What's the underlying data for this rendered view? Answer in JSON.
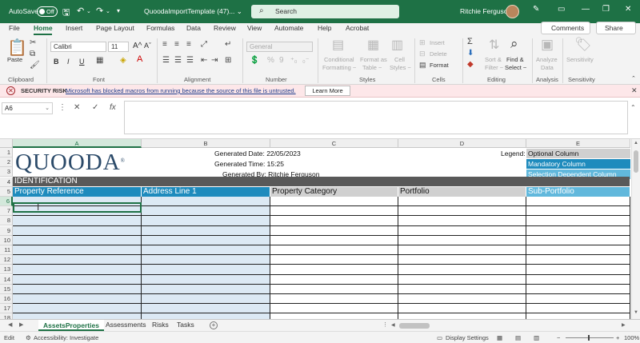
{
  "titlebar": {
    "autosave_label": "AutoSave",
    "autosave_state": "Off",
    "doc_title": "QuoodaImportTemplate (47)...",
    "doc_title_dropdown": "⌄",
    "search_placeholder": "Search",
    "user_name": "Ritchie Ferguson",
    "icons": [
      "save-icon",
      "undo-icon",
      "redo-icon",
      "customize-icon",
      "pen-icon",
      "ribbon-display-icon",
      "minimize-icon",
      "restore-icon",
      "close-icon"
    ]
  },
  "ribbon": {
    "tabs": [
      "File",
      "Home",
      "Insert",
      "Page Layout",
      "Formulas",
      "Data",
      "Review",
      "View",
      "Automate",
      "Help",
      "Acrobat"
    ],
    "active_tab": "Home",
    "comments_label": "Comments",
    "share_label": "Share",
    "clipboard": {
      "paste_label": "Paste",
      "group_label": "Clipboard"
    },
    "font": {
      "font_name": "Calibri",
      "font_size": "11",
      "bold": "B",
      "italic": "I",
      "underline": "U",
      "grow": "A^",
      "shrink": "Aˇ",
      "group_label": "Font"
    },
    "alignment": {
      "group_label": "Alignment"
    },
    "number": {
      "format": "General",
      "group_label": "Number"
    },
    "styles": {
      "conditional": "Conditional",
      "conditional2": "Formatting ~",
      "format_as": "Format as",
      "format_as2": "Table ~",
      "cell_styles": "Cell",
      "cell_styles2": "Styles ~",
      "group_label": "Styles"
    },
    "cells": {
      "insert": "Insert",
      "delete": "Delete",
      "format": "Format",
      "group_label": "Cells"
    },
    "editing": {
      "sort": "Sort &",
      "sort2": "Filter ~",
      "find": "Find &",
      "find2": "Select ~",
      "group_label": "Editing"
    },
    "analysis": {
      "analyze": "Analyze",
      "analyze2": "Data",
      "group_label": "Analysis"
    },
    "sensitivity": {
      "label": "Sensitivity",
      "group_label": "Sensitivity"
    }
  },
  "security": {
    "label": "SECURITY RISK",
    "message": "Microsoft has blocked macros from running because the source of this file is untrusted.",
    "learn_more": "Learn More"
  },
  "formula": {
    "namebox": "A6",
    "cancel_glyph": "✕",
    "enter_glyph": "✓",
    "fx_glyph": "fx",
    "value": ""
  },
  "grid": {
    "columns": [
      "A",
      "B",
      "C",
      "D",
      "E"
    ],
    "rows": [
      "1",
      "2",
      "3",
      "4",
      "5",
      "6",
      "7",
      "8",
      "9",
      "10",
      "11",
      "12",
      "13",
      "14",
      "15",
      "16",
      "17",
      "18"
    ],
    "selected_column": "A",
    "selected_row": "6",
    "logo_text": "QUOODA",
    "logo_mark": "®",
    "generated_date": "Generated Date: 22/05/2023",
    "generated_time": "Generated Time: 15:25",
    "generated_by": "Generated By: Ritchie Ferguson",
    "legend_label": "Legend:",
    "legend_optional": "Optional Column",
    "legend_mandatory": "Mandatory Column",
    "legend_selection": "Selection Dependent Column",
    "section_title": "IDENTIFICATION",
    "headers": [
      "Property Reference",
      "Address Line 1",
      "Property Category",
      "Portfolio",
      "Sub-Portfolio"
    ],
    "colors": {
      "mandatory": "#1e8bbd",
      "optional": "#d0d0d0",
      "selection": "#61b8dc",
      "section": "#595959",
      "entry": "#dce9f4"
    }
  },
  "sheets": {
    "tabs": [
      "AssetsProperties",
      "Assessments",
      "Risks",
      "Tasks"
    ],
    "active": "AssetsProperties",
    "add_glyph": "+"
  },
  "status": {
    "mode": "Edit",
    "accessibility": "Accessibility: Investigate",
    "display_settings": "Display Settings",
    "zoom": "100%"
  }
}
